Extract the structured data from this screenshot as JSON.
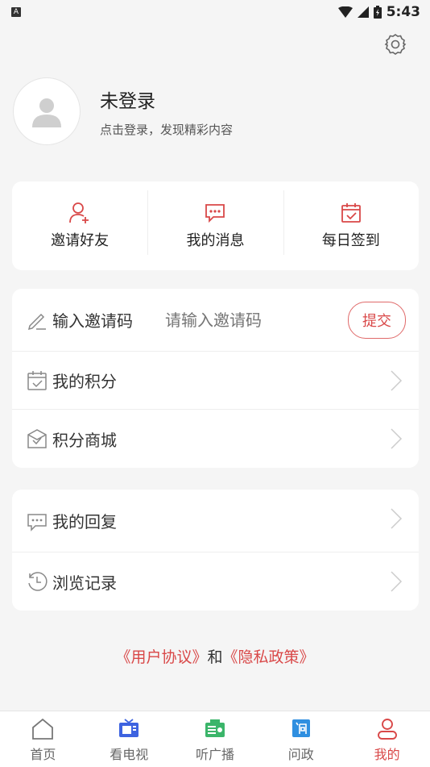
{
  "status": {
    "indicator": "A",
    "time": "5:43"
  },
  "profile": {
    "title": "未登录",
    "subtitle": "点击登录，发现精彩内容"
  },
  "quick": [
    {
      "label": "邀请好友",
      "icon": "add-user-icon"
    },
    {
      "label": "我的消息",
      "icon": "message-icon"
    },
    {
      "label": "每日签到",
      "icon": "calendar-check-icon"
    }
  ],
  "invite": {
    "label": "输入邀请码",
    "placeholder": "请输入邀请码",
    "submit": "提交"
  },
  "menu1": [
    {
      "label": "我的积分"
    },
    {
      "label": "积分商城"
    }
  ],
  "menu2": [
    {
      "label": "我的回复"
    },
    {
      "label": "浏览记录"
    }
  ],
  "agreement": {
    "user": "《用户协议》",
    "and": "和",
    "privacy": "《隐私政策》"
  },
  "tabs": [
    {
      "label": "首页"
    },
    {
      "label": "看电视"
    },
    {
      "label": "听广播"
    },
    {
      "label": "问政"
    },
    {
      "label": "我的"
    }
  ],
  "colors": {
    "accent": "#d94848",
    "tv": "#3d63e0",
    "radio": "#3bb56a",
    "wenzheng": "#2f8fe0"
  }
}
